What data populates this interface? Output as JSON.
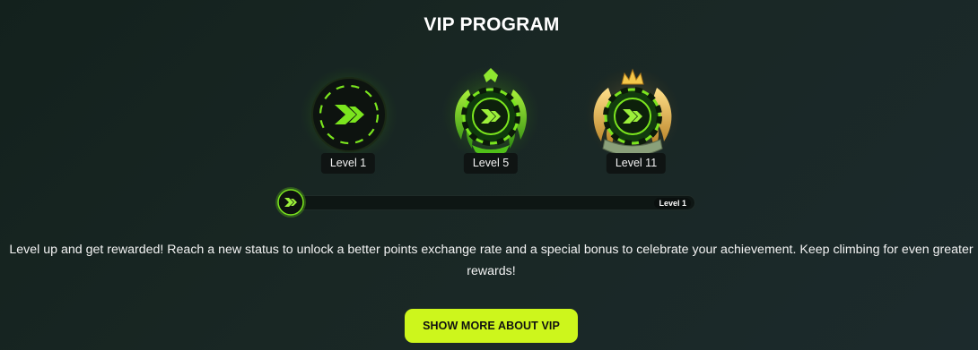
{
  "section": {
    "title": "VIP PROGRAM"
  },
  "levels": [
    {
      "label": "Level 1",
      "icon": "vip-level-1-badge-icon"
    },
    {
      "label": "Level 5",
      "icon": "vip-level-5-badge-icon"
    },
    {
      "label": "Level 11",
      "icon": "vip-level-11-badge-icon"
    }
  ],
  "progress": {
    "current_level": "Level 1",
    "fraction": 0.0
  },
  "description": "Level up and get rewarded! Reach a new status to unlock a better points exchange rate and a special bonus to celebrate your achievement. Keep climbing for even greater rewards!",
  "cta": {
    "label": "SHOW MORE ABOUT VIP"
  },
  "colors": {
    "accent": "#cdf61c",
    "chip_green": "#7be51e",
    "background": "#17241f",
    "gold": "#d9a43a"
  }
}
